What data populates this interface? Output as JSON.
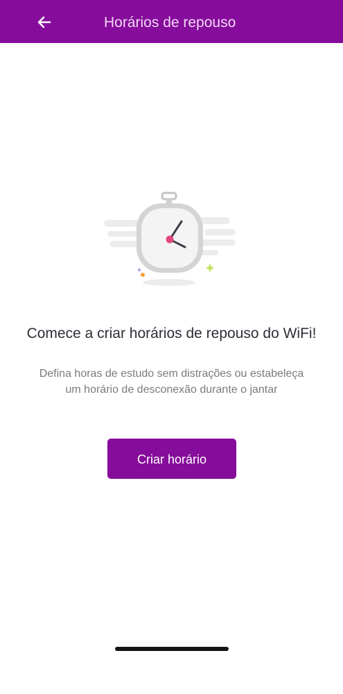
{
  "app_bar": {
    "title": "Horários de repouso",
    "back_icon": "arrow-left-icon",
    "background": "#860c9b"
  },
  "empty_state": {
    "illustration": "stopwatch-icon",
    "headline": "Comece a criar horários de repouso do WiFi!",
    "description": "Defina horas de estudo sem distrações ou estabeleça um horário de desconexão durante o jantar"
  },
  "primary_action": {
    "label": "Criar horário",
    "color": "#860c9b"
  }
}
